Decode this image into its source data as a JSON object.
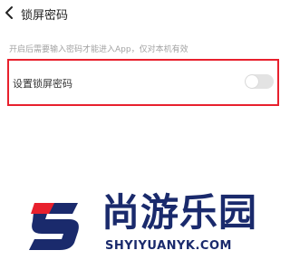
{
  "header": {
    "title": "锁屏密码",
    "back_icon": "chevron-left-icon"
  },
  "hint": "开启后需要输入密码才能进入App，仅对本机有效",
  "setting": {
    "label": "设置锁屏密码",
    "toggle_on": false
  },
  "watermark": {
    "cn": "尚游乐园",
    "en": "SHYIYUANYK.COM"
  },
  "colors": {
    "highlight_border": "#e8202d",
    "watermark_navy": "#1a2a6c",
    "watermark_red": "#e8202d",
    "toggle_track": "#e3e3e3"
  }
}
